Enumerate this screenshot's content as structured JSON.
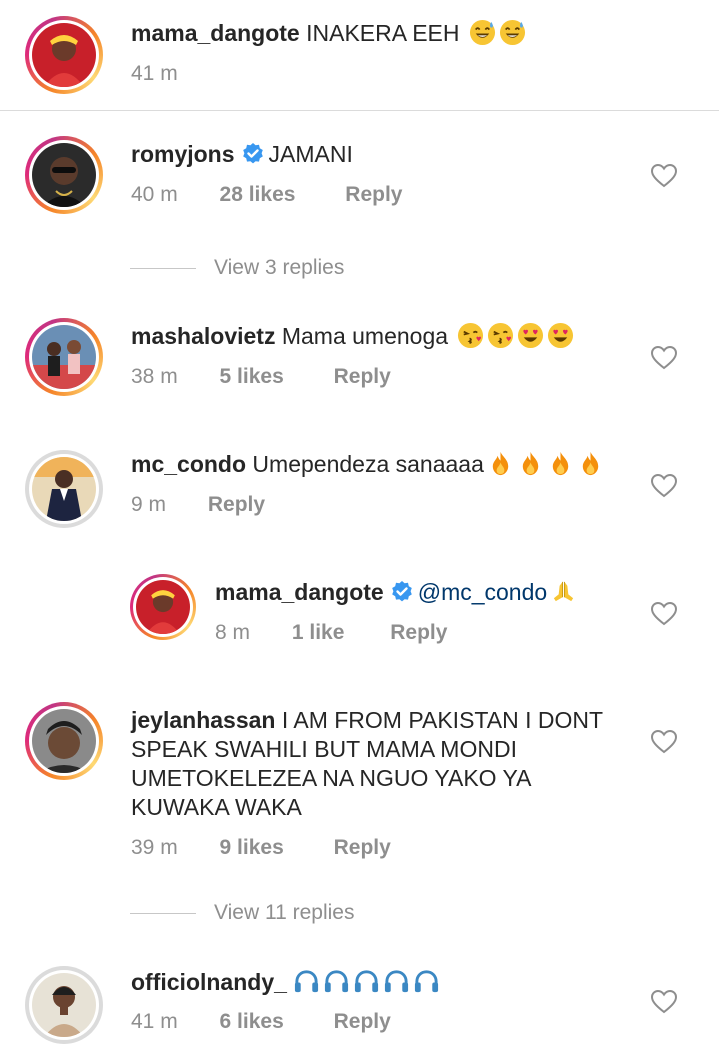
{
  "comments": [
    {
      "username": "mama_dangote",
      "text": "INAKERA EEH",
      "emojis": [
        "sweat-smile",
        "sweat-smile"
      ],
      "time": "41 m",
      "likes": "",
      "reply": ""
    },
    {
      "username": "romyjons",
      "verified": true,
      "text": "JAMANI",
      "time": "40 m",
      "likes": "28 likes",
      "reply": "Reply",
      "view_replies": "View 3 replies"
    },
    {
      "username": "mashalovietz",
      "text": "Mama umenoga",
      "emojis": [
        "kiss",
        "kiss",
        "heart-eyes",
        "heart-eyes"
      ],
      "time": "38 m",
      "likes": "5 likes",
      "reply": "Reply"
    },
    {
      "username": "mc_condo",
      "text": "Umependeza sanaaaa",
      "emojis": [
        "fire",
        "fire",
        "fire",
        "fire"
      ],
      "time": "9 m",
      "likes": "",
      "reply": "Reply"
    },
    {
      "username": "mama_dangote",
      "verified": true,
      "mention": "@mc_condo",
      "emojis": [
        "pray"
      ],
      "time": "8 m",
      "likes": "1 like",
      "reply": "Reply"
    },
    {
      "username": "jeylanhassan",
      "text": "I AM FROM PAKISTAN I DONT SPEAK SWAHILI BUT MAMA MONDI UMETOKELEZEA NA NGUO YAKO YA KUWAKA WAKA",
      "time": "39 m",
      "likes": "9 likes",
      "reply": "Reply",
      "view_replies": "View 11 replies"
    },
    {
      "username": "officiolnandy_",
      "text": "",
      "emojis": [
        "headphones",
        "headphones",
        "headphones",
        "headphones",
        "headphones"
      ],
      "time": "41 m",
      "likes": "6 likes",
      "reply": "Reply"
    }
  ],
  "colors": {
    "text": "#262626",
    "meta": "#8e8e8e",
    "mention": "#00376b",
    "verified": "#3897f0",
    "divider": "#dbdbdb"
  }
}
